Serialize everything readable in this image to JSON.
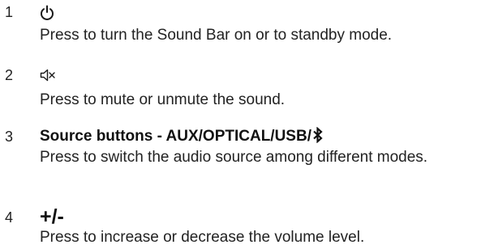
{
  "items": [
    {
      "number": "1",
      "icon": "power-icon",
      "description": "Press to turn the Sound Bar on or to standby mode."
    },
    {
      "number": "2",
      "icon": "mute-icon",
      "description": "Press to mute or unmute the sound."
    },
    {
      "number": "3",
      "heading": "Source buttons - AUX/OPTICAL/USB/",
      "heading_icon": "bluetooth-icon",
      "description": "Press to switch the audio source among different modes."
    },
    {
      "number": "4",
      "heading": "+/-",
      "description": "Press to increase or decrease the volume level."
    }
  ]
}
